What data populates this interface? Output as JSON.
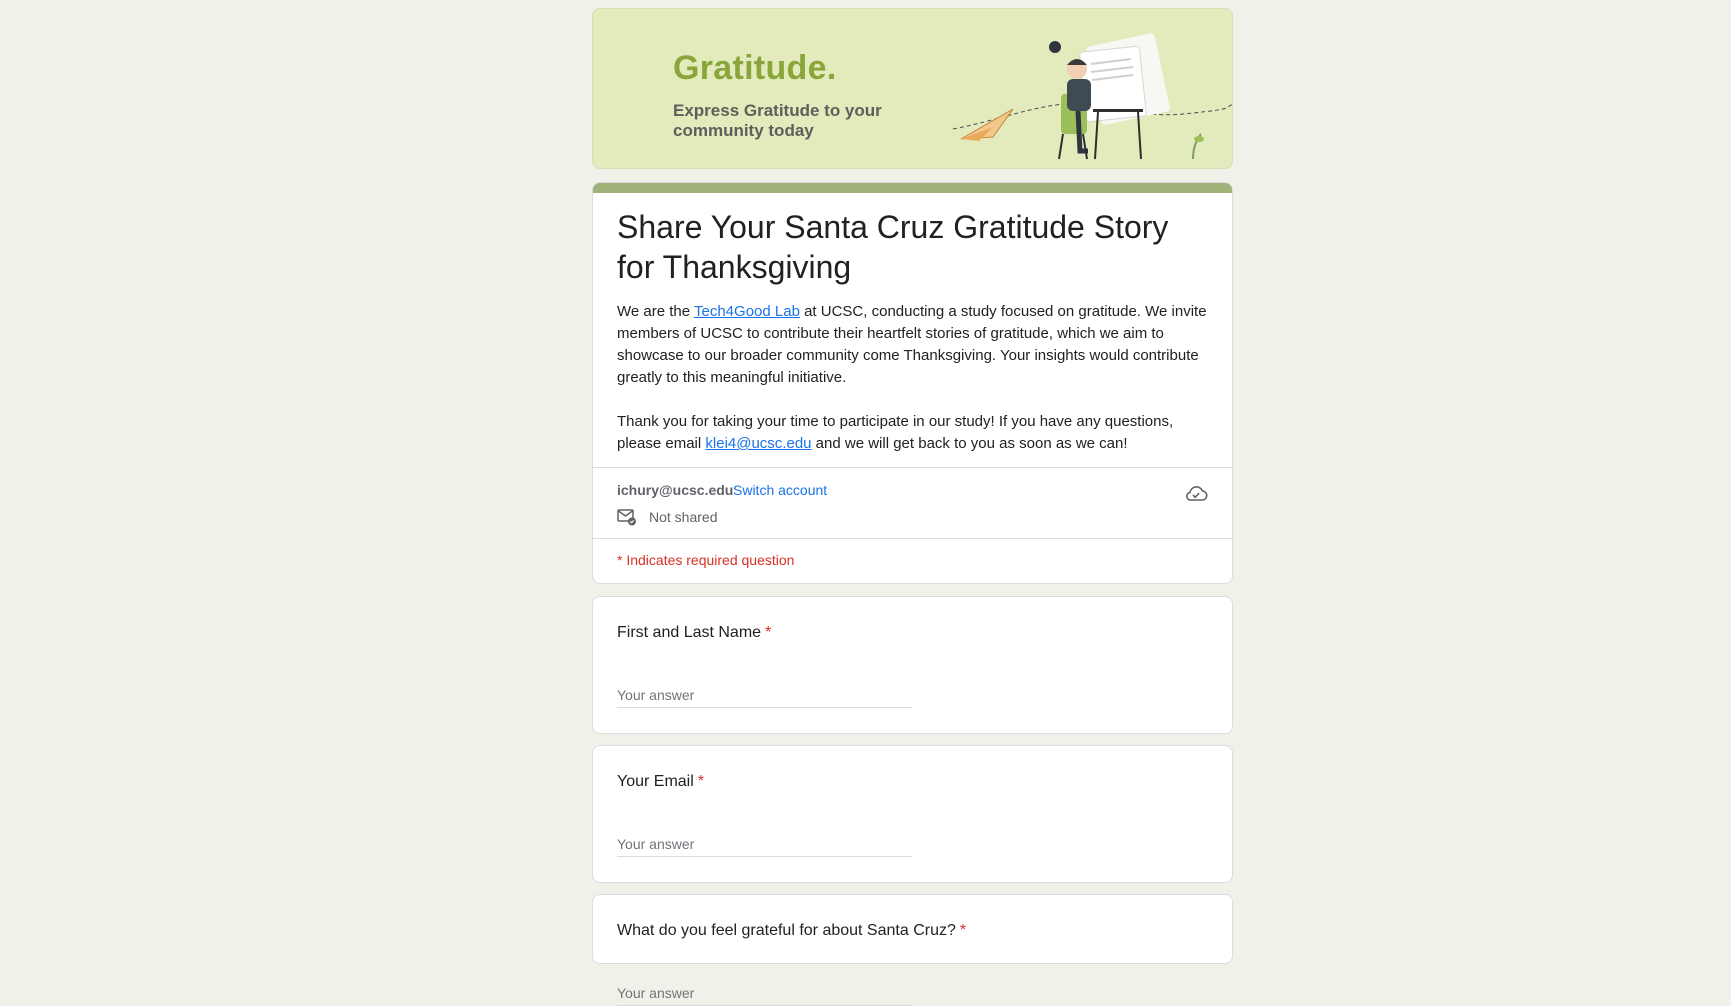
{
  "banner": {
    "title": "Gratitude.",
    "subtitle": "Express Gratitude to your community today"
  },
  "form": {
    "title": "Share Your Santa Cruz Gratitude Story for Thanksgiving",
    "desc_p1_before": "We are the ",
    "desc_p1_link": "Tech4Good Lab",
    "desc_p1_after": " at UCSC, conducting a study focused on gratitude. We invite members of UCSC to contribute their heartfelt stories of gratitude, which we aim to showcase to our broader community come Thanksgiving. Your insights would contribute greatly to this meaningful initiative.",
    "desc_p2_before": "Thank you for taking your time to participate in our study! If you have any questions, please email ",
    "desc_p2_link": "klei4@ucsc.edu",
    "desc_p2_after": " and we will get back to you as soon as we can!",
    "required_note": "* Indicates required question"
  },
  "account": {
    "email": "ichury@ucsc.edu",
    "switch_label": "Switch account",
    "shared_status": "Not shared"
  },
  "questions": [
    {
      "label": "First and Last Name",
      "required_mark": "*",
      "placeholder": "Your answer"
    },
    {
      "label": "Your Email",
      "required_mark": "*",
      "placeholder": "Your answer"
    },
    {
      "label": "What do you feel grateful for about Santa Cruz?",
      "required_mark": "*",
      "placeholder": "Your answer"
    }
  ],
  "colors": {
    "background": "#f0f2e9",
    "banner_bg": "#e3ebbd",
    "accent_bar": "#a0b27a",
    "link": "#1a73e8",
    "required": "#d93025"
  },
  "icons": [
    "paper-plane-icon",
    "envelope-shared-icon",
    "cloud-icon"
  ]
}
